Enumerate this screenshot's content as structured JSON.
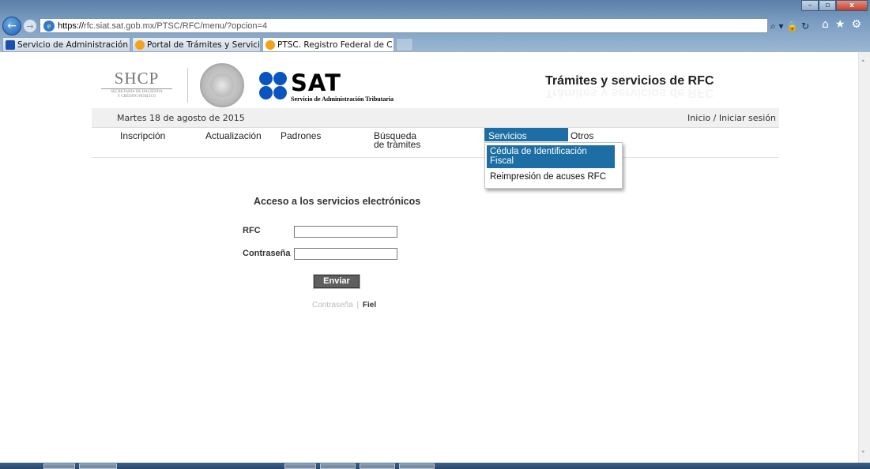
{
  "browser": {
    "url_prefix": "https://",
    "url_domain": "rfc.siat.sat.gob.mx",
    "url_path": "/PTSC/RFC/menu/?opcion=4",
    "tabs": [
      {
        "label": "Servicio de Administración Tri..."
      },
      {
        "label": "Portal de Trámites y Servicios a..."
      },
      {
        "label": "PTSC. Registro Federal de C..."
      }
    ],
    "tab_close": "×",
    "window_buttons": {
      "minimize": "–",
      "maximize": "▫",
      "close": "x"
    },
    "back_icon": "←",
    "forward_icon": "→",
    "address_tools": "⌕ ▾ 🔒 ↻",
    "toolbar_icons": {
      "home": "⌂",
      "favorites": "★",
      "settings": "⚙"
    }
  },
  "header": {
    "shcp_title": "SHCP",
    "shcp_subtitle_1": "SECRETARÍA DE HACIENDA",
    "shcp_subtitle_2": "Y CRÉDITO PÚBLICO",
    "sat_title": "SAT",
    "sat_subtitle": "Servicio de Administración Tributaria",
    "page_title": "Trámites y servicios de RFC"
  },
  "date_bar": {
    "date": "Martes 18 de agosto de 2015",
    "inicio": "Inicio",
    "separator": "/",
    "iniciar_sesion": "Iniciar sesión"
  },
  "nav": {
    "items": [
      {
        "label": "Inscripción"
      },
      {
        "label": "Actualización"
      },
      {
        "label": "Padrones"
      },
      {
        "label": "Búsqueda de trámites"
      },
      {
        "label": "Servicios"
      },
      {
        "label": "Otros"
      }
    ],
    "dropdown": [
      {
        "label": "Cédula de Identificación Fiscal"
      },
      {
        "label": "Reimpresión de acuses RFC"
      }
    ]
  },
  "form": {
    "title": "Acceso a los servicios electrónicos",
    "rfc_label": "RFC",
    "rfc_value": "",
    "password_label": "Contraseña",
    "password_value": "",
    "submit_label": "Enviar",
    "link_contrasena": "Contraseña",
    "link_separator": "|",
    "link_fiel": "Fiel"
  },
  "scrollbar": {
    "up": "˄",
    "down": "˅"
  },
  "colors": {
    "accent": "#1c6ea4",
    "sat_blue": "#0a54c0",
    "button": "#5f5f5f"
  }
}
